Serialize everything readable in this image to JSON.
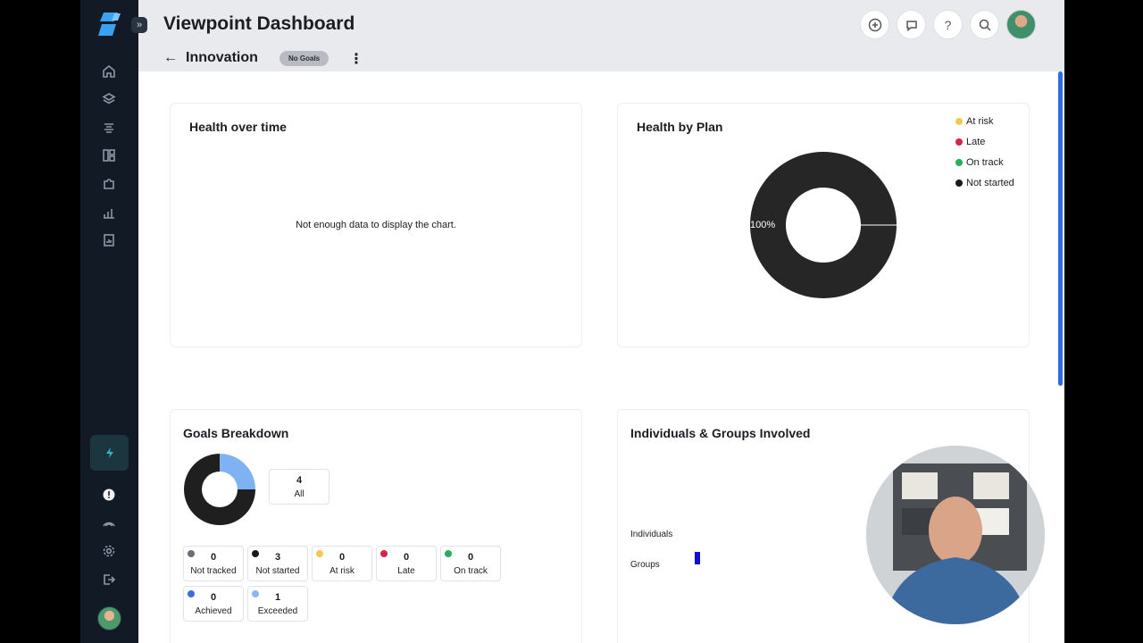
{
  "header": {
    "title": "Viewpoint Dashboard",
    "back_icon": "←",
    "subtitle": "Innovation",
    "badge": "No Goals",
    "more_icon": "⋮",
    "help_icon": "?"
  },
  "sidebar": {
    "expand_icon": "»",
    "items": [
      "home-icon",
      "layers-icon",
      "list-icon",
      "layout-icon",
      "puzzle-icon",
      "bar-chart-icon",
      "report-icon"
    ],
    "bottom_items": [
      "bolt-icon",
      "alert-icon",
      "signal-icon",
      "gear-icon",
      "logout-icon"
    ]
  },
  "health_over_time": {
    "title": "Health over time",
    "empty_message": "Not enough data to display the chart."
  },
  "health_by_plan": {
    "title": "Health by Plan",
    "legend": [
      {
        "label": "At risk",
        "color": "#f2c94c"
      },
      {
        "label": "Late",
        "color": "#d6244a"
      },
      {
        "label": "On track",
        "color": "#27ae60"
      },
      {
        "label": "Not started",
        "color": "#1a1a1a"
      }
    ],
    "chart_data": {
      "type": "pie",
      "slices": [
        {
          "label": "Not started",
          "value": 100,
          "color": "#262626"
        }
      ],
      "data_label": "100%"
    }
  },
  "goals_breakdown": {
    "title": "Goals Breakdown",
    "total": {
      "value": "4",
      "label": "All"
    },
    "chart_data": {
      "type": "pie",
      "slices": [
        {
          "label": "Not started",
          "value": 3,
          "color": "#1f1f1f"
        },
        {
          "label": "Exceeded",
          "value": 1,
          "color": "#7fb2f2"
        }
      ]
    },
    "stats": [
      {
        "value": "0",
        "label": "Not tracked",
        "color": "#6b6f75"
      },
      {
        "value": "3",
        "label": "Not started",
        "color": "#1a1a1a"
      },
      {
        "value": "0",
        "label": "At risk",
        "color": "#f2c94c"
      },
      {
        "value": "0",
        "label": "Late",
        "color": "#d6244a"
      },
      {
        "value": "0",
        "label": "On track",
        "color": "#27ae60"
      },
      {
        "value": "0",
        "label": "Achieved",
        "color": "#3a6fd8"
      },
      {
        "value": "1",
        "label": "Exceeded",
        "color": "#8ab8f0"
      }
    ]
  },
  "individuals_groups": {
    "title": "Individuals & Groups Involved",
    "chart_data": {
      "type": "bar",
      "categories": [
        "Individuals",
        "Groups"
      ],
      "values": [
        0,
        1
      ],
      "color": "#1010d0"
    }
  }
}
